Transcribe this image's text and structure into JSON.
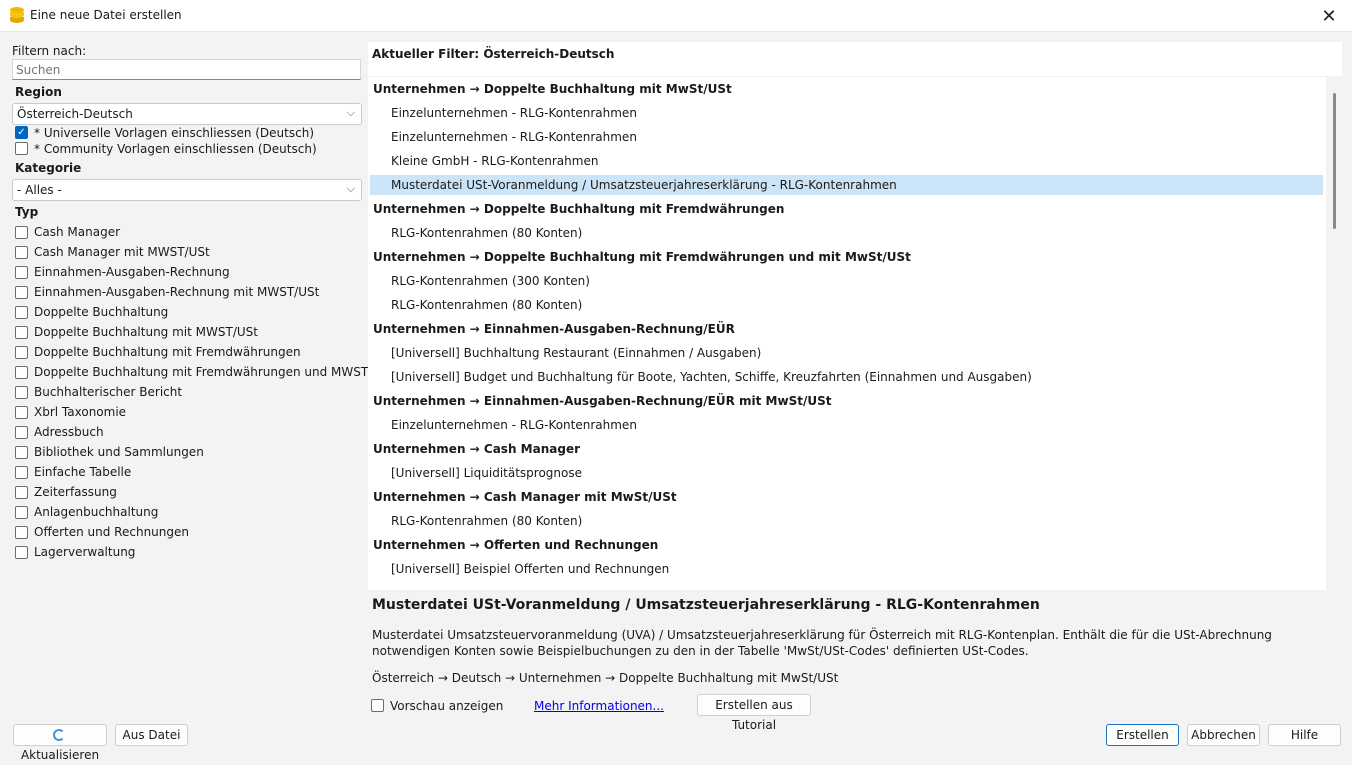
{
  "window": {
    "title": "Eine neue Datei erstellen",
    "close": "✕"
  },
  "filter": {
    "label": "Filtern nach:",
    "search_placeholder": "Suchen",
    "region_label": "Region",
    "region_value": "Österreich-Deutsch",
    "universal_label": "* Universelle Vorlagen einschliessen (Deutsch)",
    "universal_checked": true,
    "community_label": "* Community Vorlagen einschliessen (Deutsch)",
    "community_checked": false,
    "category_label": "Kategorie",
    "category_value": "- Alles -",
    "type_label": "Typ",
    "types": [
      "Cash Manager",
      "Cash Manager mit MWST/USt",
      "Einnahmen-Ausgaben-Rechnung",
      "Einnahmen-Ausgaben-Rechnung mit MWST/USt",
      "Doppelte Buchhaltung",
      "Doppelte Buchhaltung mit MWST/USt",
      "Doppelte Buchhaltung mit Fremdwährungen",
      "Doppelte Buchhaltung mit Fremdwährungen und MWST/USt",
      "Buchhalterischer Bericht",
      "Xbrl Taxonomie",
      "Adressbuch",
      "Bibliothek und Sammlungen",
      "Einfache Tabelle",
      "Zeiterfassung",
      "Anlagenbuchhaltung",
      "Offerten und Rechnungen",
      "Lagerverwaltung"
    ]
  },
  "list": {
    "current_filter": "Aktueller Filter: Österreich-Deutsch",
    "rows": [
      {
        "kind": "group",
        "text": "Unternehmen → Doppelte Buchhaltung mit MwSt/USt"
      },
      {
        "kind": "item",
        "text": "Einzelunternehmen - RLG-Kontenrahmen"
      },
      {
        "kind": "item",
        "text": "Einzelunternehmen - RLG-Kontenrahmen"
      },
      {
        "kind": "item",
        "text": "Kleine GmbH - RLG-Kontenrahmen"
      },
      {
        "kind": "item",
        "text": "Musterdatei USt-Voranmeldung / Umsatzsteuerjahreserklärung - RLG-Kontenrahmen",
        "selected": true
      },
      {
        "kind": "group",
        "text": "Unternehmen → Doppelte Buchhaltung mit Fremdwährungen"
      },
      {
        "kind": "item",
        "text": "RLG-Kontenrahmen (80 Konten)"
      },
      {
        "kind": "group",
        "text": "Unternehmen → Doppelte Buchhaltung mit Fremdwährungen und mit MwSt/USt"
      },
      {
        "kind": "item",
        "text": "RLG-Kontenrahmen (300 Konten)"
      },
      {
        "kind": "item",
        "text": "RLG-Kontenrahmen (80 Konten)"
      },
      {
        "kind": "group",
        "text": "Unternehmen → Einnahmen-Ausgaben-Rechnung/EÜR"
      },
      {
        "kind": "item",
        "text": "[Universell] Buchhaltung Restaurant (Einnahmen / Ausgaben)"
      },
      {
        "kind": "item",
        "text": "[Universell] Budget und Buchhaltung für Boote, Yachten, Schiffe, Kreuzfahrten (Einnahmen und Ausgaben)"
      },
      {
        "kind": "group",
        "text": "Unternehmen → Einnahmen-Ausgaben-Rechnung/EÜR mit MwSt/USt"
      },
      {
        "kind": "item",
        "text": "Einzelunternehmen - RLG-Kontenrahmen"
      },
      {
        "kind": "group",
        "text": "Unternehmen → Cash Manager"
      },
      {
        "kind": "item",
        "text": "[Universell] Liquiditätsprognose"
      },
      {
        "kind": "group",
        "text": "Unternehmen → Cash Manager mit MwSt/USt"
      },
      {
        "kind": "item",
        "text": "RLG-Kontenrahmen (80 Konten)"
      },
      {
        "kind": "group",
        "text": "Unternehmen → Offerten und Rechnungen"
      },
      {
        "kind": "item",
        "text": "[Universell] Beispiel Offerten und Rechnungen"
      }
    ]
  },
  "details": {
    "title": "Musterdatei USt-Voranmeldung / Umsatzsteuerjahreserklärung - RLG-Kontenrahmen",
    "description": "Musterdatei Umsatzsteuervoranmeldung (UVA) / Umsatzsteuerjahreserklärung für Österreich mit RLG-Kontenplan. Enthält die für die USt-Abrechnung notwendigen Konten sowie Beispielbuchungen zu den in der Tabelle 'MwSt/USt-Codes' definierten USt-Codes.",
    "path": "Österreich → Deutsch → Unternehmen → Doppelte Buchhaltung mit MwSt/USt",
    "preview_label": "Vorschau anzeigen",
    "more_info": "Mehr Informationen...",
    "tutorial_button": "Erstellen aus Tutorial"
  },
  "footer": {
    "refresh": "Aktualisieren",
    "from_file": "Aus Datei",
    "create": "Erstellen",
    "cancel": "Abbrechen",
    "help": "Hilfe"
  }
}
